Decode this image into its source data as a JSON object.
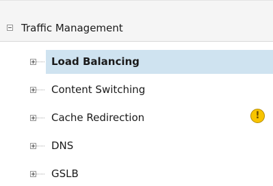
{
  "tree": {
    "header": {
      "label": "Traffic Management",
      "expanded": true
    },
    "items": [
      {
        "label": "Load Balancing",
        "selected": true,
        "expandable": true
      },
      {
        "label": "Content Switching",
        "selected": false,
        "expandable": true
      },
      {
        "label": "Cache Redirection",
        "selected": false,
        "expandable": true,
        "status_icon": "warning-icon",
        "warning_glyph": "!"
      },
      {
        "label": "DNS",
        "selected": false,
        "expandable": true
      },
      {
        "label": "GSLB",
        "selected": false,
        "expandable": true
      }
    ]
  },
  "colors": {
    "selected_row": "#cfe3f0",
    "warning": "#f8c400",
    "header_background": "#f5f5f5"
  }
}
